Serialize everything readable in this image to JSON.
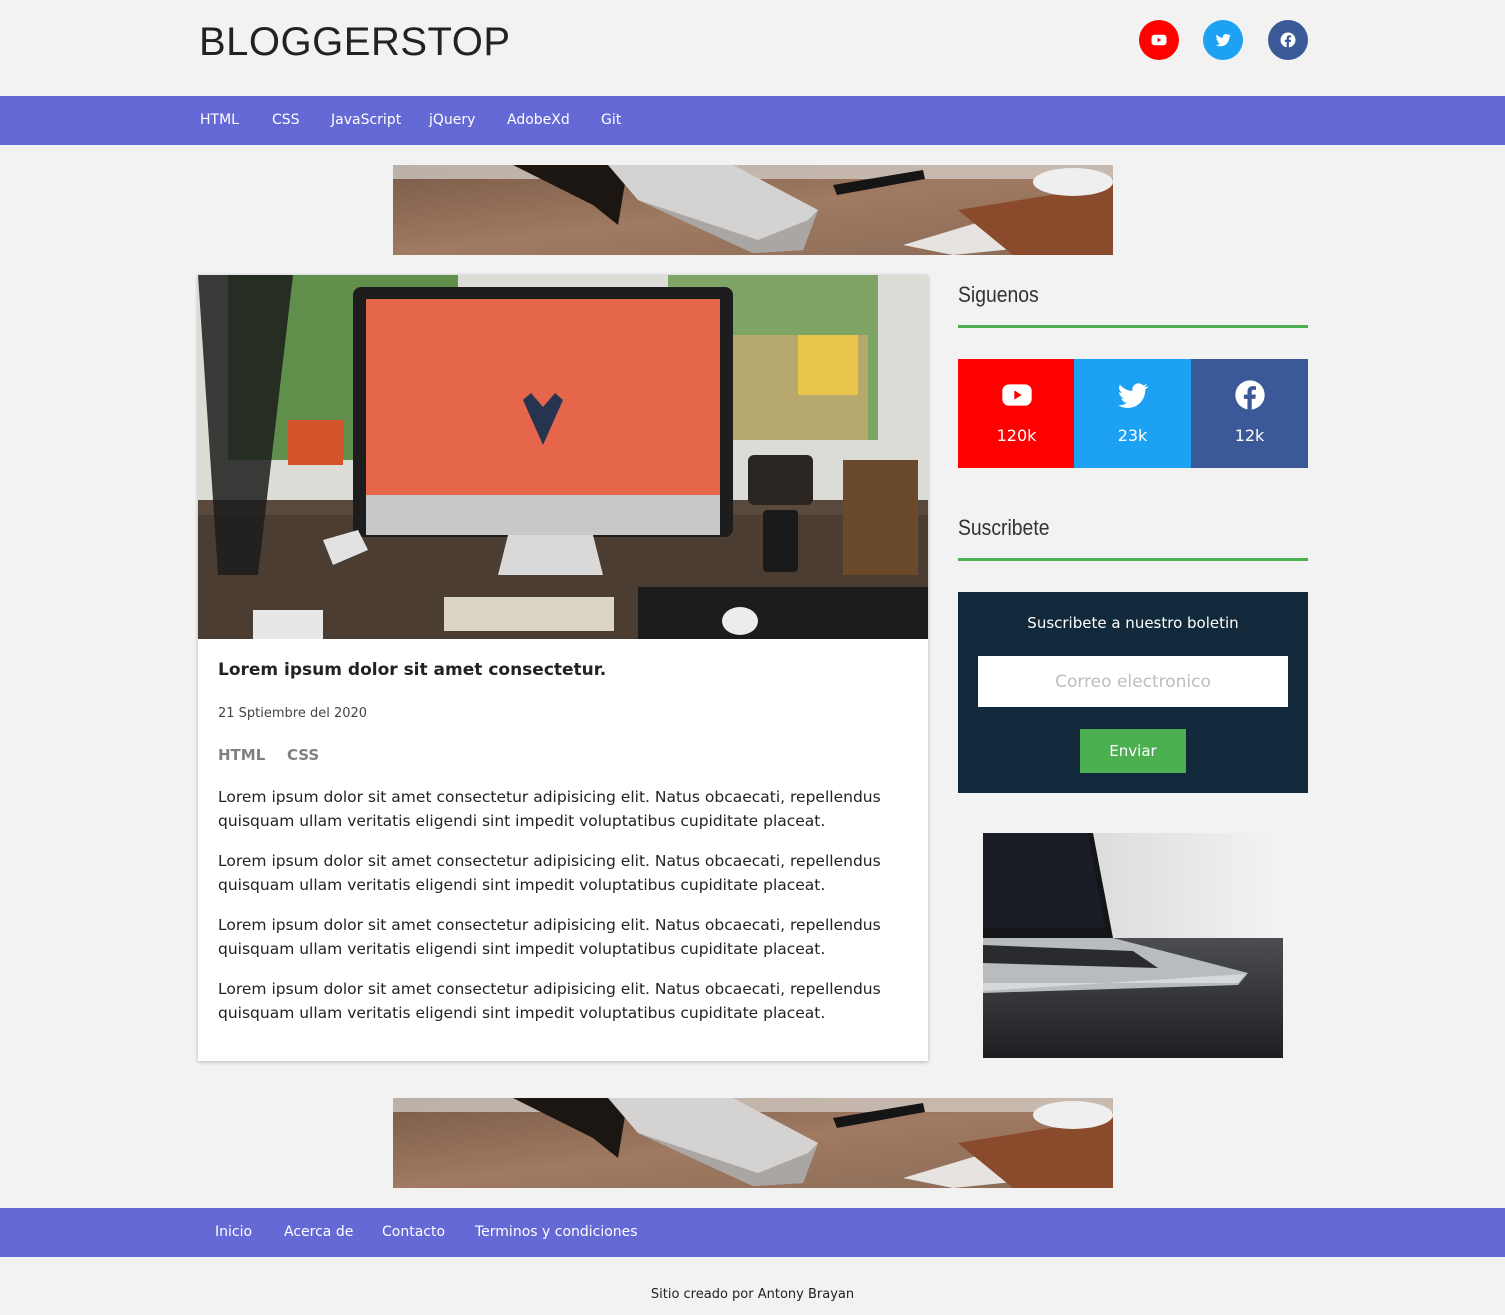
{
  "site": {
    "title": "BLOGGERSTOP"
  },
  "header": {
    "social": [
      {
        "name": "youtube",
        "icon": "youtube-icon",
        "color": "#ff0000"
      },
      {
        "name": "twitter",
        "icon": "twitter-icon",
        "color": "#1da1f2"
      },
      {
        "name": "facebook",
        "icon": "facebook-icon",
        "color": "#3b5998"
      }
    ]
  },
  "nav": {
    "items": [
      "HTML",
      "CSS",
      "JavaScript",
      "jQuery",
      "AdobeXd",
      "Git"
    ]
  },
  "post": {
    "title": "Lorem ipsum dolor sit amet consectetur.",
    "date": "21 Sptiembre del 2020",
    "tags": [
      "HTML",
      "CSS"
    ],
    "paragraphs": [
      "Lorem ipsum dolor sit amet consectetur adipisicing elit. Natus obcaecati, repellendus quisquam ullam veritatis eligendi sint impedit voluptatibus cupiditate placeat.",
      "Lorem ipsum dolor sit amet consectetur adipisicing elit. Natus obcaecati, repellendus quisquam ullam veritatis eligendi sint impedit voluptatibus cupiditate placeat.",
      "Lorem ipsum dolor sit amet consectetur adipisicing elit. Natus obcaecati, repellendus quisquam ullam veritatis eligendi sint impedit voluptatibus cupiditate placeat.",
      "Lorem ipsum dolor sit amet consectetur adipisicing elit. Natus obcaecati, repellendus quisquam ullam veritatis eligendi sint impedit voluptatibus cupiditate placeat."
    ]
  },
  "sidebar": {
    "follow_title": "Siguenos",
    "stats": [
      {
        "network": "youtube",
        "icon": "youtube-icon",
        "count": "120k",
        "color": "#ff0000"
      },
      {
        "network": "twitter",
        "icon": "twitter-icon",
        "count": "23k",
        "color": "#1da1f2"
      },
      {
        "network": "facebook",
        "icon": "facebook-icon",
        "count": "12k",
        "color": "#3b5998"
      }
    ],
    "subscribe_title": "Suscribete",
    "newsletter": {
      "text": "Suscribete a nuestro boletin",
      "placeholder": "Correo electronico",
      "button": "Enviar"
    }
  },
  "footer": {
    "links": [
      "Inicio",
      "Acerca de",
      "Contacto",
      "Terminos y condiciones"
    ],
    "credit": "Sitio creado por Antony Brayan"
  },
  "colors": {
    "accent": "#6469d6",
    "green": "#4caf50",
    "newsletter_bg": "#11293a"
  }
}
